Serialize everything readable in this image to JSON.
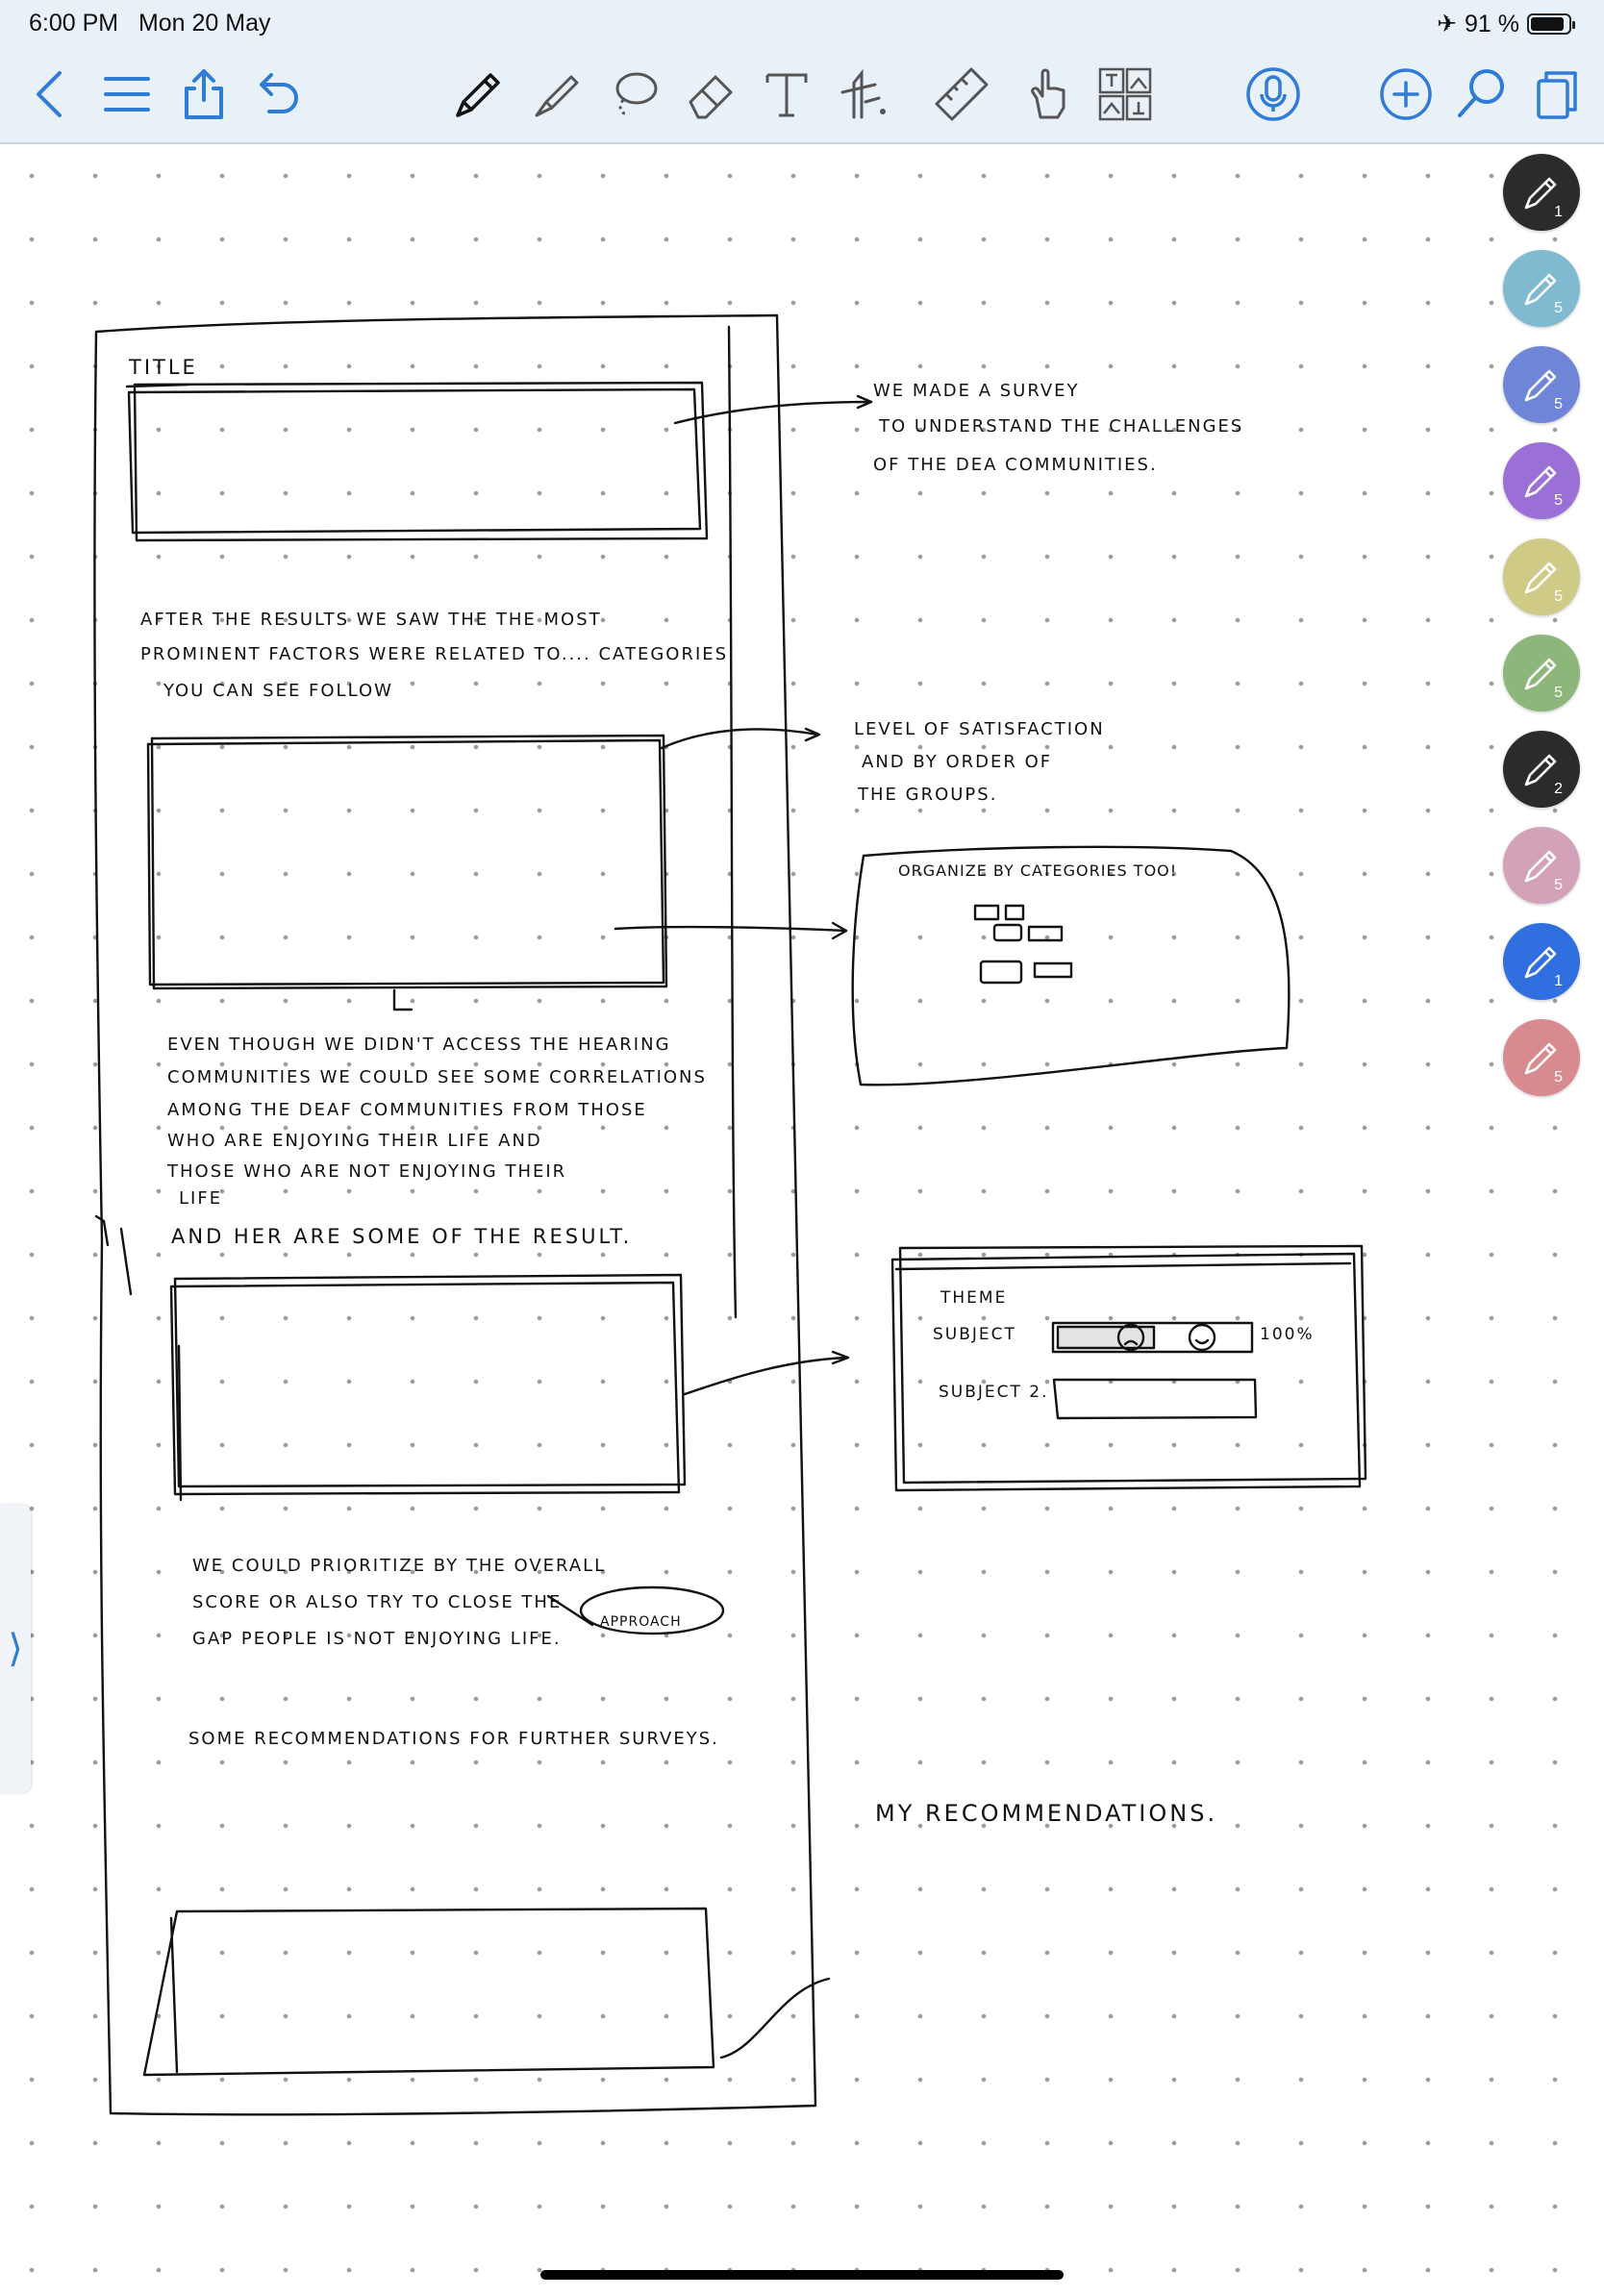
{
  "status_bar": {
    "time": "6:00 PM",
    "date": "Mon 20 May",
    "airplane_icon": "airplane-icon",
    "battery_percent": "91 %"
  },
  "toolbar": {
    "left": [
      "back-icon",
      "list-icon",
      "share-icon",
      "undo-icon"
    ],
    "tools": [
      "pen-icon",
      "highlighter-icon",
      "lasso-icon",
      "eraser-icon",
      "text-icon",
      "elements-icon",
      "ruler-icon",
      "hand-icon",
      "image-icon"
    ],
    "right": [
      "microphone-icon",
      "add-page-icon",
      "search-icon",
      "pages-icon"
    ],
    "accent": "#2f7bd6"
  },
  "pens": [
    {
      "color": "#2b2b2b",
      "size": "1"
    },
    {
      "color": "#7fbad0",
      "size": "5"
    },
    {
      "color": "#6f86d8",
      "size": "5"
    },
    {
      "color": "#9a6fd6",
      "size": "5"
    },
    {
      "color": "#cfcb86",
      "size": "5"
    },
    {
      "color": "#8db67a",
      "size": "5"
    },
    {
      "color": "#2b2b2b",
      "size": "2"
    },
    {
      "color": "#d4a2b8",
      "size": "5"
    },
    {
      "color": "#2f6fe0",
      "size": "1"
    },
    {
      "color": "#d88a8e",
      "size": "5"
    }
  ],
  "notes": {
    "title": "TITLE",
    "survey_note": [
      "WE MADE A SURVEY",
      "TO UNDERSTAND THE CHALLENGES",
      "OF THE DEA COMMUNITIES."
    ],
    "after_results": [
      "AFTER THE RESULTS WE SAW THE THE MOST",
      "PROMINENT FACTORS WERE RELATED TO.... CATEGORIES",
      "YOU CAN SEE FOLLOW"
    ],
    "satisfaction_note": [
      "LEVEL OF SATISFACTION",
      "AND BY ORDER OF",
      "THE GROUPS."
    ],
    "organize": "ORGANIZE BY CATEGORIES TOO!",
    "even_though": [
      "EVEN THOUGH WE DIDN'T ACCESS THE HEARING",
      "COMMUNITIES WE COULD SEE SOME CORRELATIONS",
      "AMONG THE DEAF COMMUNITIES FROM THOSE",
      "WHO ARE ENJOYING THEIR LIFE AND",
      "THOSE WHO ARE NOT ENJOYING THEIR",
      "LIFE"
    ],
    "and_here": "AND HER ARE SOME OF THE RESULT.",
    "theme": "THEME",
    "subject": "SUBJECT",
    "subject2": "SUBJECT 2.",
    "percent": "100%",
    "prioritize": [
      "WE COULD PRIORITIZE BY THE OVERALL",
      "SCORE OR ALSO TRY TO CLOSE THE",
      "GAP PEOPLE IS NOT ENJOYING LIFE."
    ],
    "approach": "APPROACH",
    "recommendations": "SOME RECOMMENDATIONS FOR FURTHER SURVEYS.",
    "my_recommendations": "MY RECOMMENDATIONS."
  }
}
